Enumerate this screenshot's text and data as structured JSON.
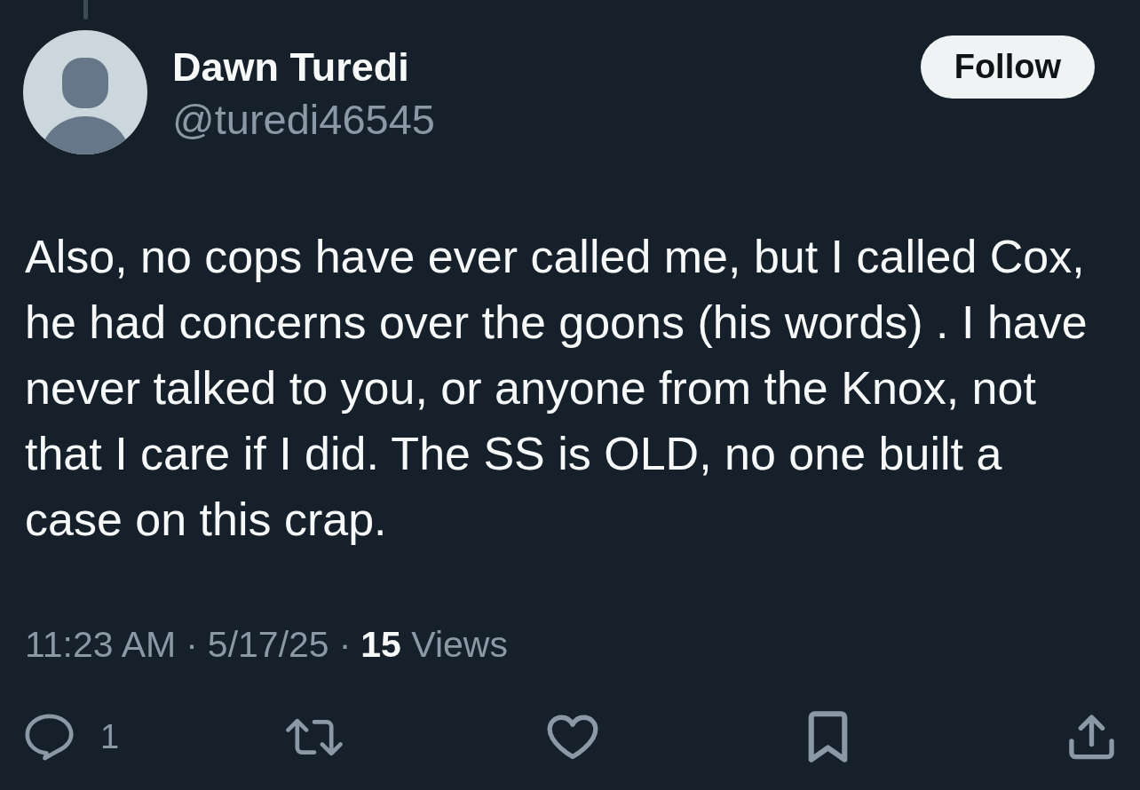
{
  "thread_connector": true,
  "author": {
    "display_name": "Dawn Turedi",
    "handle": "@turedi46545",
    "follow_button": "Follow"
  },
  "post": {
    "text": "Also, no cops have ever called me, but I called Cox, he had concerns over the goons (his words) . I have never talked to you, or anyone from the Knox, not that I care if I did. The SS is OLD, no one built a case on this crap."
  },
  "meta": [
    {
      "kind": "time",
      "text": "11:23 AM"
    },
    {
      "kind": "separator",
      "text": "·"
    },
    {
      "kind": "date",
      "text": "5/17/25"
    },
    {
      "kind": "separator",
      "text": "·"
    },
    {
      "kind": "views",
      "text": "**15** Views"
    }
  ],
  "actions": [
    {
      "kind": "reply",
      "count": "1"
    },
    {
      "kind": "repost"
    },
    {
      "kind": "like"
    },
    {
      "kind": "bookmark"
    },
    {
      "kind": "share"
    }
  ]
}
